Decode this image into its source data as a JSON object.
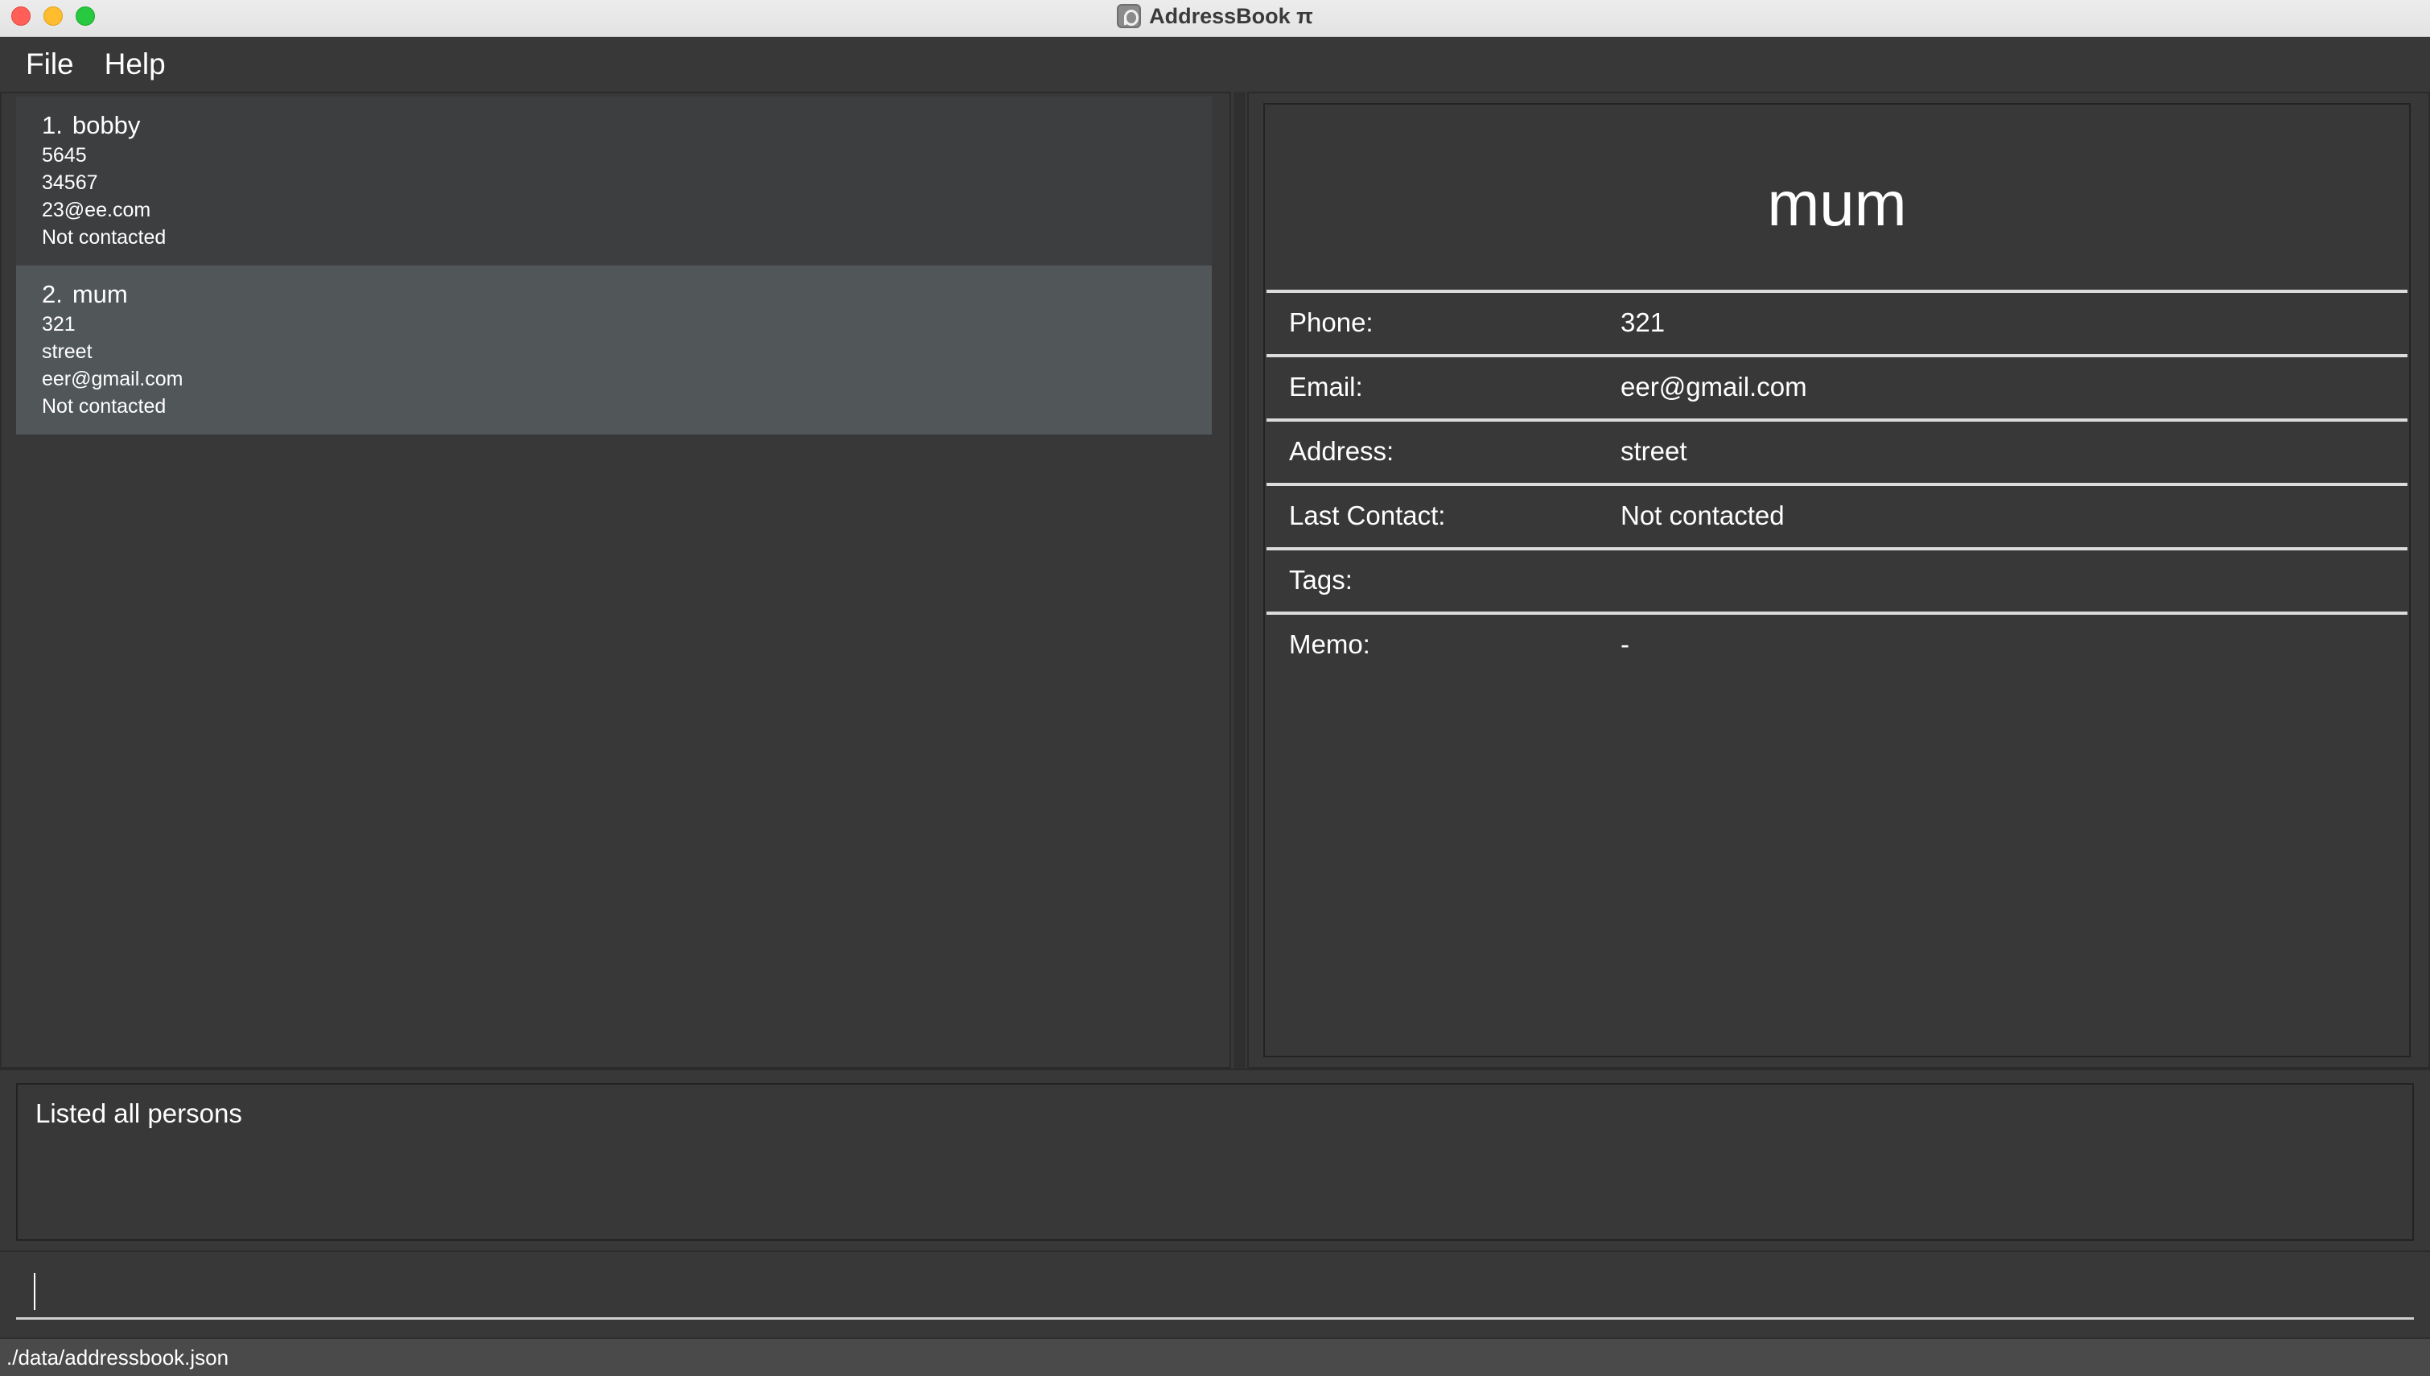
{
  "window": {
    "title": "AddressBook π",
    "app_icon": "addressbook-app-icon"
  },
  "menu": {
    "items": [
      {
        "label": "File"
      },
      {
        "label": "Help"
      }
    ]
  },
  "person_list": [
    {
      "index": "1.",
      "name": "bobby",
      "phone": "5645",
      "address": "34567",
      "email": "23@ee.com",
      "last_contact": "Not contacted"
    },
    {
      "index": "2.",
      "name": "mum",
      "phone": "321",
      "address": "street",
      "email": "eer@gmail.com",
      "last_contact": "Not contacted"
    }
  ],
  "detail": {
    "name": "mum",
    "rows": [
      {
        "label": "Phone:",
        "value": "321"
      },
      {
        "label": "Email:",
        "value": "eer@gmail.com"
      },
      {
        "label": "Address:",
        "value": "street"
      },
      {
        "label": "Last Contact:",
        "value": "Not contacted"
      },
      {
        "label": "Tags:",
        "value": ""
      },
      {
        "label": "Memo:",
        "value": "-"
      }
    ]
  },
  "result": {
    "text": "Listed all persons"
  },
  "command": {
    "value": ""
  },
  "status": {
    "file_path": "./data/addressbook.json"
  },
  "colors": {
    "background": "#383838",
    "selected_card": "#515659",
    "card": "#3c3e3f",
    "status_bar": "#4a4a4a"
  }
}
